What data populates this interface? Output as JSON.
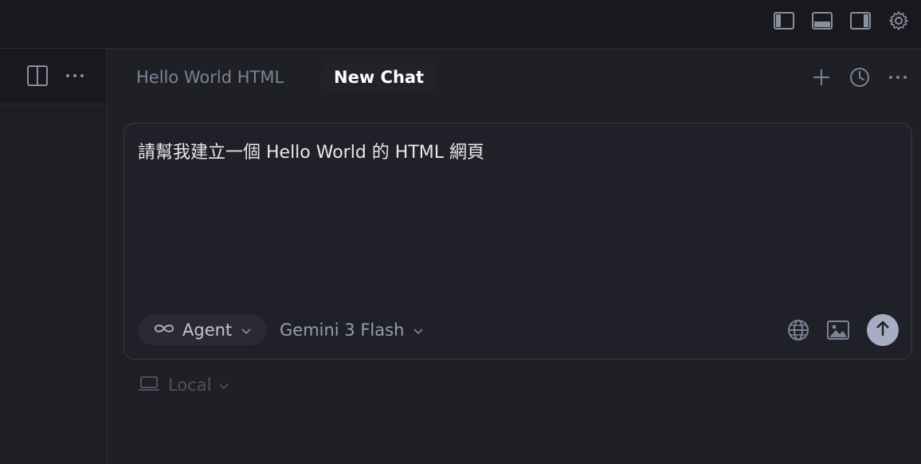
{
  "titlebar": {
    "icons": [
      "sidebar-left-toggle-icon",
      "panel-bottom-toggle-icon",
      "sidebar-right-toggle-icon",
      "gear-icon"
    ]
  },
  "sidebar": {
    "icons": [
      "split-panel-icon",
      "more-horizontal-icon"
    ]
  },
  "tabs": [
    {
      "label": "Hello World HTML",
      "active": false
    },
    {
      "label": "New Chat",
      "active": true
    }
  ],
  "header_icons": [
    "plus-icon",
    "history-clock-icon",
    "more-horizontal-icon"
  ],
  "composer": {
    "text": "請幫我建立一個 Hello World 的 HTML 網頁",
    "mode": {
      "label": "Agent",
      "icon": "infinity-icon"
    },
    "model": {
      "label": "Gemini 3 Flash"
    },
    "tools": [
      "globe-icon",
      "image-icon"
    ],
    "send_icon": "arrow-up-icon"
  },
  "environment": {
    "label": "Local",
    "icon": "laptop-icon"
  },
  "colors": {
    "background": "#1f1f26",
    "titlebar": "#18181e",
    "send_button": "#a6adc4",
    "muted_text": "#7c8396"
  }
}
